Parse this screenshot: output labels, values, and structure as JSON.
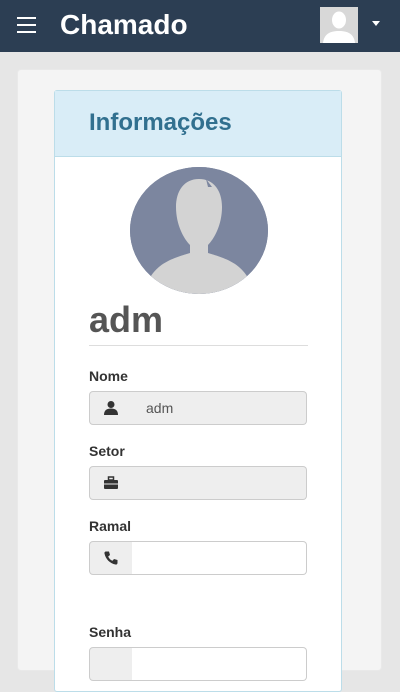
{
  "navbar": {
    "brand": "Chamado",
    "menu_icon": "hamburger-icon",
    "user_avatar_icon": "user-avatar-icon",
    "dropdown_icon": "caret-down-icon"
  },
  "panel": {
    "title": "Informações",
    "profile_icon": "user-silhouette-icon",
    "username": "adm"
  },
  "fields": {
    "nome": {
      "label": "Nome",
      "value": "adm",
      "icon": "user-icon",
      "readonly": true
    },
    "setor": {
      "label": "Setor",
      "value": "",
      "icon": "briefcase-icon",
      "readonly": true
    },
    "ramal": {
      "label": "Ramal",
      "value": "",
      "icon": "phone-icon",
      "readonly": false
    },
    "senha": {
      "label": "Senha",
      "value": "",
      "readonly": false
    }
  },
  "colors": {
    "navbar_bg": "#2c3e53",
    "panel_header_bg": "#d9edf7",
    "panel_title": "#31708f",
    "avatar_bg": "#7c869f"
  }
}
